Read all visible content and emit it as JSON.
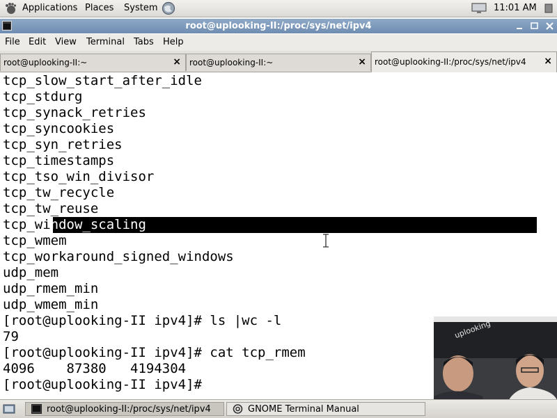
{
  "top_panel": {
    "menus": [
      "Applications",
      "Places",
      "System"
    ],
    "clock": "11:01 AM"
  },
  "window": {
    "title": "root@uplooking-II:/proc/sys/net/ipv4"
  },
  "menubar": [
    "File",
    "Edit",
    "View",
    "Terminal",
    "Tabs",
    "Help"
  ],
  "tabs": [
    {
      "label": "root@uplooking-II:~",
      "active": false
    },
    {
      "label": "root@uplooking-II:~",
      "active": false
    },
    {
      "label": "root@uplooking-II:/proc/sys/net/ipv4",
      "active": true
    }
  ],
  "terminal": {
    "lines": [
      "tcp_slow_start_after_idle",
      "tcp_stdurg",
      "tcp_synack_retries",
      "tcp_syncookies",
      "tcp_syn_retries",
      "tcp_timestamps",
      "tcp_tso_win_divisor",
      "tcp_tw_recycle",
      "tcp_tw_reuse",
      "tcp_window_scaling",
      "tcp_wmem",
      "tcp_workaround_signed_windows",
      "udp_mem",
      "udp_rmem_min",
      "udp_wmem_min",
      "[root@uplooking-II ipv4]# ls |wc -l",
      "79",
      "[root@uplooking-II ipv4]# cat tcp_rmem",
      "4096\t87380\t4194304",
      "[root@uplooking-II ipv4]#"
    ],
    "selected_line": {
      "before": "tcp_wi",
      "after": "ndow_scaling"
    }
  },
  "taskbar": [
    {
      "label": "root@uplooking-II:/proc/sys/net/ipv4",
      "icon": "terminal-icon"
    },
    {
      "label": "GNOME Terminal Manual",
      "icon": "help-icon"
    }
  ],
  "video_overlay": {
    "banner_text": "uplooking"
  }
}
